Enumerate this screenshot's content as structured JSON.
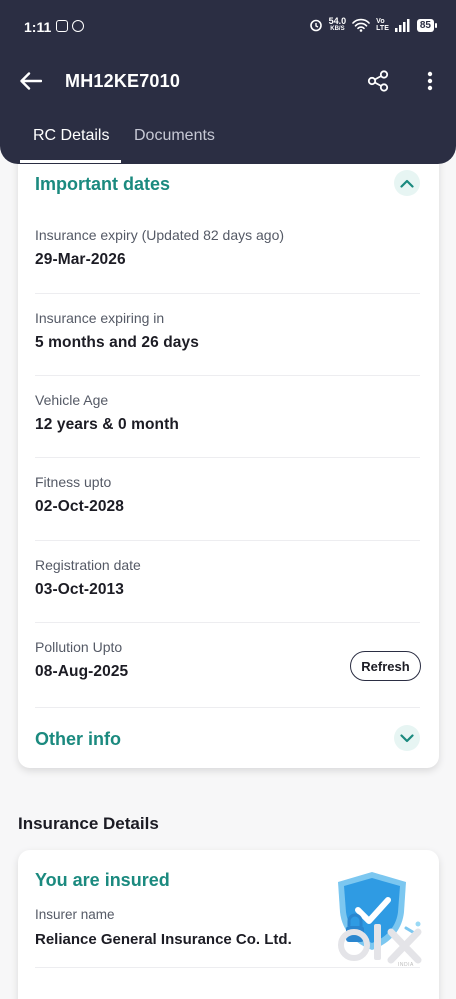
{
  "status_bar": {
    "time": "1:11",
    "net_speed": "54.0",
    "net_speed_unit": "KB/S",
    "volte_top": "Vo",
    "volte_bottom": "LTE",
    "battery": "85"
  },
  "app_bar": {
    "title": "MH12KE7010"
  },
  "tabs": [
    {
      "label": "RC Details",
      "active": true
    },
    {
      "label": "Documents",
      "active": false
    }
  ],
  "important_dates": {
    "heading": "Important dates",
    "rows": [
      {
        "label": "Insurance expiry (Updated 82 days ago)",
        "value": "29-Mar-2026"
      },
      {
        "label": "Insurance expiring in",
        "value": "5 months and 26 days"
      },
      {
        "label": "Vehicle Age",
        "value": "12 years & 0 month"
      },
      {
        "label": "Fitness upto",
        "value": "02-Oct-2028"
      },
      {
        "label": "Registration date",
        "value": "03-Oct-2013"
      },
      {
        "label": "Pollution Upto",
        "value": "08-Aug-2025"
      }
    ],
    "refresh_label": "Refresh"
  },
  "other_info": {
    "heading": "Other info"
  },
  "insurance": {
    "section_title": "Insurance Details",
    "status": "You are insured",
    "insurer_label": "Insurer name",
    "insurer_value": "Reliance General Insurance Co. Ltd."
  },
  "watermark": {
    "brand": "olx",
    "sub": "INDIA"
  },
  "colors": {
    "header_bg": "#2b2e43",
    "accent_teal": "#1b8a7f",
    "chevron_bg": "#e7f5f3"
  }
}
